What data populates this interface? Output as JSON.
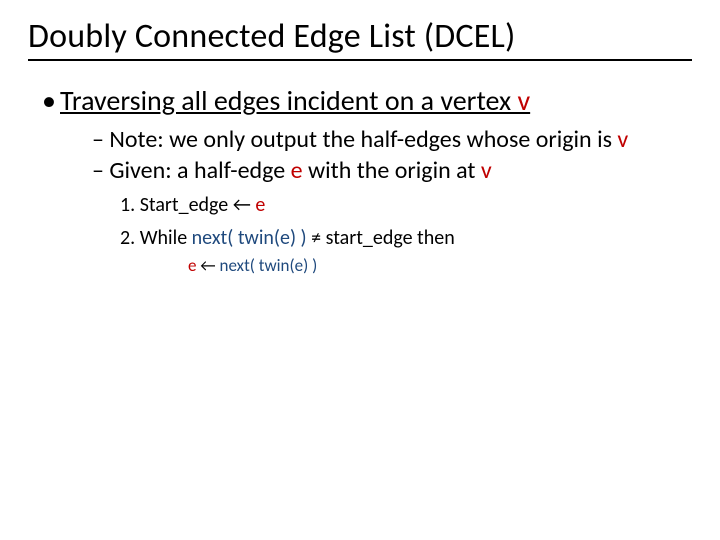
{
  "title": "Doubly Connected Edge List (DCEL)",
  "bullet1_prefix": "Traversing all edges incident on a vertex ",
  "bullet1_v": "v",
  "note_dash": "– ",
  "note_a": "Note: we only output the half-edges whose origin is ",
  "note_v": "v",
  "given_a": "Given: a half-edge ",
  "given_e": "e",
  "given_b": " with the origin at ",
  "given_v": "v",
  "step1_a": "1.  Start_edge ← ",
  "step1_e": "e",
  "step2_a": "2.  While ",
  "step2_b": "next( twin(e) )",
  "step2_c": " ≠ start_edge then",
  "step3_a": "e",
  "step3_b": " ← ",
  "step3_c": "next( twin(e) )"
}
